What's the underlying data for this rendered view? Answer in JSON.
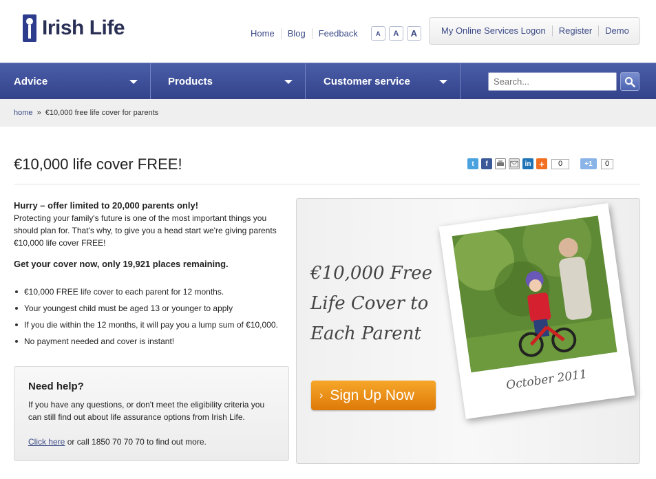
{
  "brand": {
    "name": "Irish Life"
  },
  "toplinks": [
    "Home",
    "Blog",
    "Feedback"
  ],
  "font_sizes": [
    "A",
    "A",
    "A"
  ],
  "online": [
    "My Online Services Logon",
    "Register",
    "Demo"
  ],
  "nav": {
    "items": [
      "Advice",
      "Products",
      "Customer service"
    ],
    "search_placeholder": "Search..."
  },
  "breadcrumb": {
    "home": "home",
    "separator": "»",
    "current": "€10,000 free life cover for parents"
  },
  "page": {
    "title": "€10,000 life cover FREE!",
    "share_count_1": "0",
    "share_count_2": "0",
    "plus_one": "+1"
  },
  "intro": {
    "hurry": "Hurry – offer limited to 20,000 parents only!",
    "body": "Protecting your family's future is one of the most important things you should plan for. That's why, to give you a head start we're giving parents €10,000 life cover FREE!",
    "get": "Get your cover now, only 19,921 places remaining."
  },
  "bullets": [
    "€10,000 FREE life cover to each parent for 12 months.",
    "Your youngest child must be aged 13 or younger to apply",
    "If you die within the 12 months, it will pay you a lump sum of €10,000.",
    "No payment needed and cover is instant!"
  ],
  "help": {
    "title": "Need help?",
    "body": "If you have any questions, or don't meet the eligibility criteria you can still find out about life assurance options from Irish Life.",
    "link": "Click here",
    "tail": " or call 1850 70 70 70 to find out more."
  },
  "promo": {
    "line1": "€10,000 Free",
    "line2": "Life Cover to",
    "line3": "Each Parent",
    "button": "Sign Up Now",
    "caption": "October 2011"
  },
  "colors": {
    "nav": "#3a4a96",
    "accent": "#e8850f",
    "link": "#3b4a86"
  }
}
